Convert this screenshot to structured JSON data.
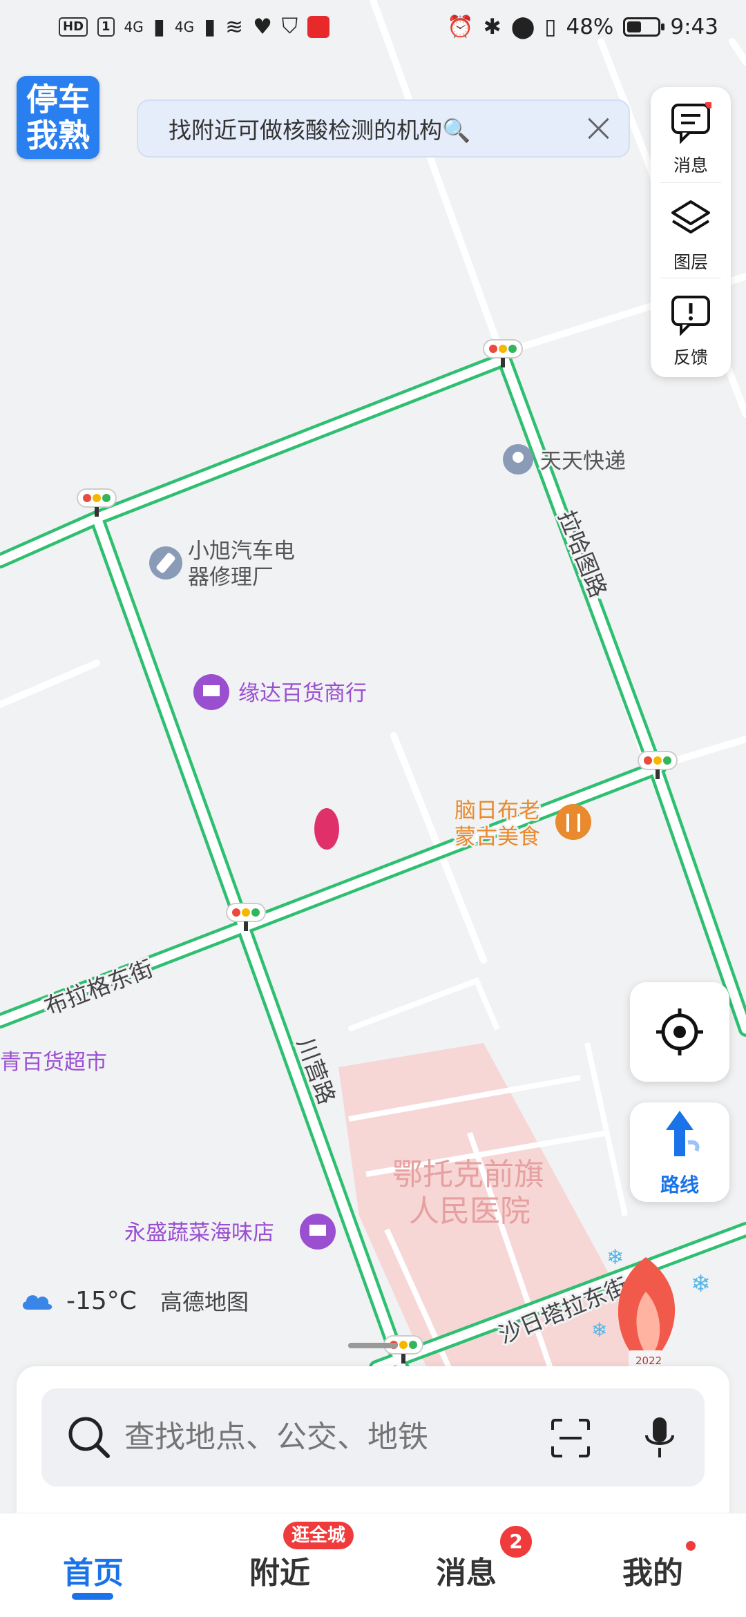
{
  "status_bar": {
    "left_chips": [
      "HD",
      "1"
    ],
    "network_1": "4G",
    "network_2": "4G",
    "battery_text": "48%",
    "battery_level": 0.48,
    "time": "9:43"
  },
  "app_logo": {
    "line1": "停车",
    "line2": "我熟"
  },
  "banner": {
    "text": "找附近可做核酸检测的机构🔍"
  },
  "side_panel": {
    "messages_label": "消息",
    "layers_label": "图层",
    "feedback_label": "反馈"
  },
  "map": {
    "pois": {
      "express": "天天快递",
      "repair_line1": "小旭汽车电",
      "repair_line2": "器修理厂",
      "store": "缘达百货商行",
      "food_line1": "脑日布老",
      "food_line2": "蒙古美食",
      "supermarket": "青百货超市",
      "seafood": "永盛蔬菜海味店",
      "hospital_line1": "鄂托克前旗",
      "hospital_line2": "人民医院",
      "olympic_year": "2022"
    },
    "roads": {
      "lahatu": "拉哈图路",
      "bulage": "布拉格东街",
      "chuanying": "川营路",
      "sharitala": "沙日塔拉东街"
    },
    "colors": {
      "road_traffic": "#2fbf71",
      "hospital_area": "#f7d6d6",
      "poi_purple": "#9a4fd1",
      "poi_food": "#e88a2d"
    }
  },
  "route_button": {
    "label": "路线"
  },
  "weather": {
    "temp": "-15°C",
    "source": "高德地图"
  },
  "search": {
    "placeholder": "查找地点、公交、地铁"
  },
  "tabs": [
    {
      "label": "首页",
      "active": true
    },
    {
      "label": "附近",
      "badge": "逛全城"
    },
    {
      "label": "消息",
      "badge": "2"
    },
    {
      "label": "我的",
      "dot": true
    }
  ]
}
